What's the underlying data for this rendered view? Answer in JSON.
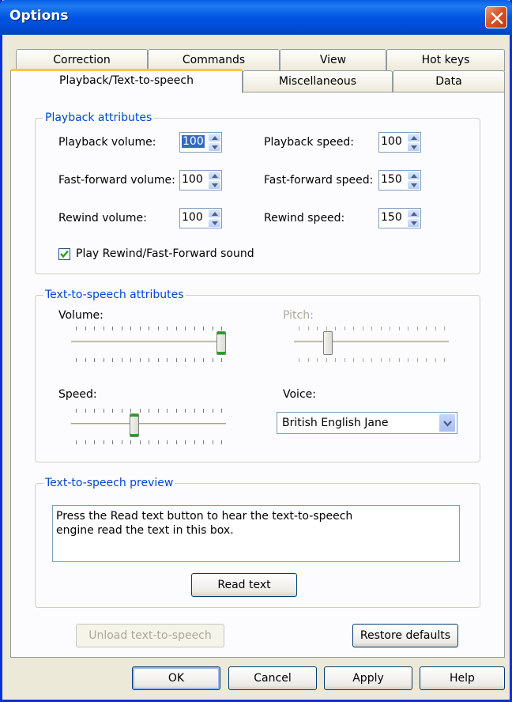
{
  "window": {
    "title": "Options"
  },
  "tabs": {
    "row1": [
      "Correction",
      "Commands",
      "View",
      "Hot keys"
    ],
    "row2": [
      "Playback/Text-to-speech",
      "Miscellaneous",
      "Data"
    ],
    "active": "Playback/Text-to-speech"
  },
  "playback": {
    "legend": "Playback attributes",
    "playback_volume": {
      "label": "Playback volume:",
      "value": "100"
    },
    "playback_speed": {
      "label": "Playback speed:",
      "value": "100"
    },
    "ff_volume": {
      "label": "Fast-forward volume:",
      "value": "100"
    },
    "ff_speed": {
      "label": "Fast-forward speed:",
      "value": "150"
    },
    "rewind_volume": {
      "label": "Rewind volume:",
      "value": "100"
    },
    "rewind_speed": {
      "label": "Rewind speed:",
      "value": "150"
    },
    "sound_checkbox": {
      "label": "Play Rewind/Fast-Forward sound",
      "checked": true
    }
  },
  "tts": {
    "legend": "Text-to-speech attributes",
    "volume": {
      "label": "Volume:",
      "level": 1.0
    },
    "pitch": {
      "label": "Pitch:",
      "level": 0.2,
      "enabled": false
    },
    "speed": {
      "label": "Speed:",
      "level": 0.4
    },
    "voice": {
      "label": "Voice:",
      "value": "British English Jane"
    }
  },
  "preview": {
    "legend": "Text-to-speech preview",
    "text_line1": "Press the Read text button to hear the text-to-speech",
    "text_line2": "engine read the text in this box.",
    "read_button": "Read text"
  },
  "actions": {
    "unload": "Unload text-to-speech",
    "restore": "Restore defaults",
    "ok": "OK",
    "cancel": "Cancel",
    "apply": "Apply",
    "help": "Help"
  },
  "colors": {
    "title_bar": "#0054e3",
    "group_legend": "#0046d5",
    "active_tab_accent": "#ffc83c"
  }
}
